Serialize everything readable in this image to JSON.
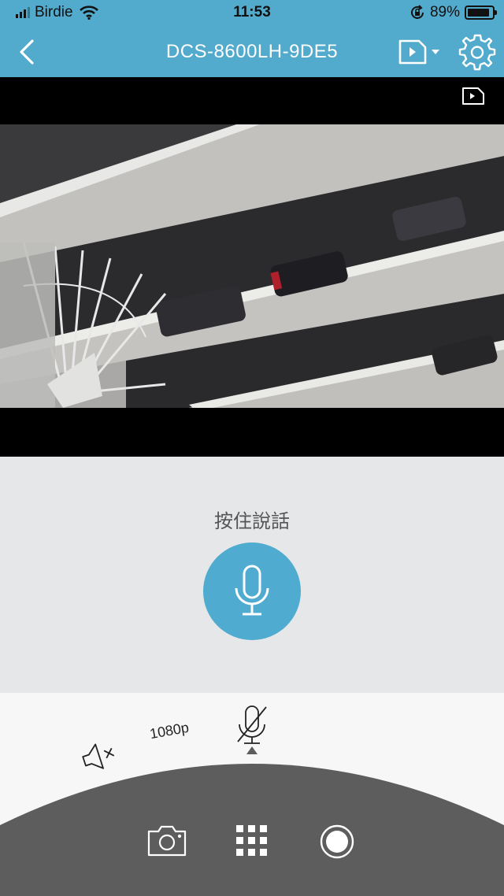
{
  "status_bar": {
    "carrier": "Birdie",
    "time": "11:53",
    "battery_percent": "89%",
    "battery_level": 0.89,
    "icons": [
      "cellular-signal-icon",
      "wifi-icon",
      "orientation-lock-icon",
      "battery-icon"
    ]
  },
  "nav": {
    "title": "DCS-8600LH-9DE5",
    "back_icon": "chevron-left-icon",
    "playback_icon": "playback-dropdown-icon",
    "settings_icon": "gear-icon"
  },
  "talk": {
    "label": "按住說話",
    "icon": "microphone-icon"
  },
  "dial": {
    "resolution": "1080p",
    "mute_icon": "speaker-muted-icon",
    "mic_off_icon": "microphone-off-icon"
  },
  "toolbar": {
    "icons": [
      "camera-icon",
      "grid-icon",
      "record-icon"
    ]
  },
  "colors": {
    "accent": "#52aacd",
    "mic_button": "#4fabcf",
    "background": "#e5e7e8",
    "dial_light": "#f7f7f7",
    "dial_dark": "#5d5d5d"
  }
}
